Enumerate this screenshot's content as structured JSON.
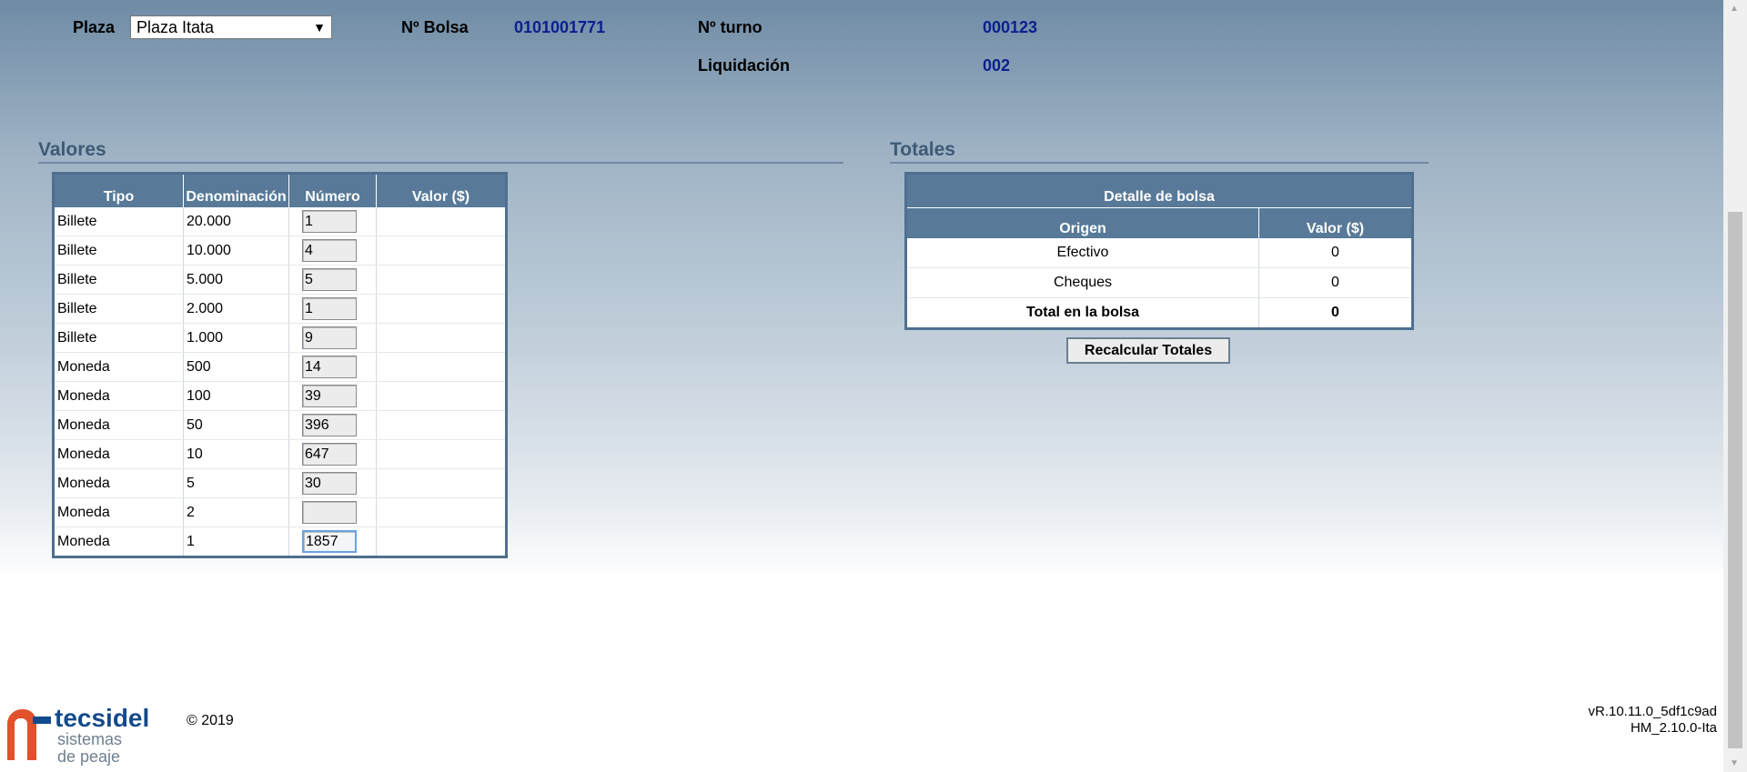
{
  "header": {
    "plaza_label": "Plaza",
    "plaza_selected": "Plaza Itata",
    "bolsa_label": "Nº Bolsa",
    "bolsa_value": "0101001771",
    "turno_label": "Nº turno",
    "turno_value": "000123",
    "liquidacion_label": "Liquidación",
    "liquidacion_value": "002"
  },
  "valores": {
    "title": "Valores",
    "columns": [
      "Tipo",
      "Denominación",
      "Número",
      "Valor ($)"
    ],
    "rows": [
      {
        "tipo": "Billete",
        "denominacion": "20.000",
        "numero": "1",
        "valor": ""
      },
      {
        "tipo": "Billete",
        "denominacion": "10.000",
        "numero": "4",
        "valor": ""
      },
      {
        "tipo": "Billete",
        "denominacion": "5.000",
        "numero": "5",
        "valor": ""
      },
      {
        "tipo": "Billete",
        "denominacion": "2.000",
        "numero": "1",
        "valor": ""
      },
      {
        "tipo": "Billete",
        "denominacion": "1.000",
        "numero": "9",
        "valor": ""
      },
      {
        "tipo": "Moneda",
        "denominacion": "500",
        "numero": "14",
        "valor": ""
      },
      {
        "tipo": "Moneda",
        "denominacion": "100",
        "numero": "39",
        "valor": ""
      },
      {
        "tipo": "Moneda",
        "denominacion": "50",
        "numero": "396",
        "valor": ""
      },
      {
        "tipo": "Moneda",
        "denominacion": "10",
        "numero": "647",
        "valor": ""
      },
      {
        "tipo": "Moneda",
        "denominacion": "5",
        "numero": "30",
        "valor": ""
      },
      {
        "tipo": "Moneda",
        "denominacion": "2",
        "numero": "",
        "valor": ""
      },
      {
        "tipo": "Moneda",
        "denominacion": "1",
        "numero": "1857",
        "valor": ""
      }
    ]
  },
  "totales": {
    "title": "Totales",
    "table_title": "Detalle de bolsa",
    "columns": [
      "Origen",
      "Valor ($)"
    ],
    "rows": [
      {
        "origen": "Efectivo",
        "valor": "0"
      },
      {
        "origen": "Cheques",
        "valor": "0"
      }
    ],
    "total_label": "Total en la bolsa",
    "total_value": "0",
    "recalc_button": "Recalcular Totales"
  },
  "footer": {
    "brand": "tecsidel",
    "brand_sub1": "sistemas",
    "brand_sub2": "de peaje",
    "copyright": "© 2019",
    "version1": "vR.10.11.0_5df1c9ad",
    "version2": "HM_2.10.0-Ita"
  },
  "colors": {
    "header_bg": "#587a98",
    "value_text": "#0a1f8f",
    "brand": "#134a8c",
    "logo": "#e1512b"
  }
}
